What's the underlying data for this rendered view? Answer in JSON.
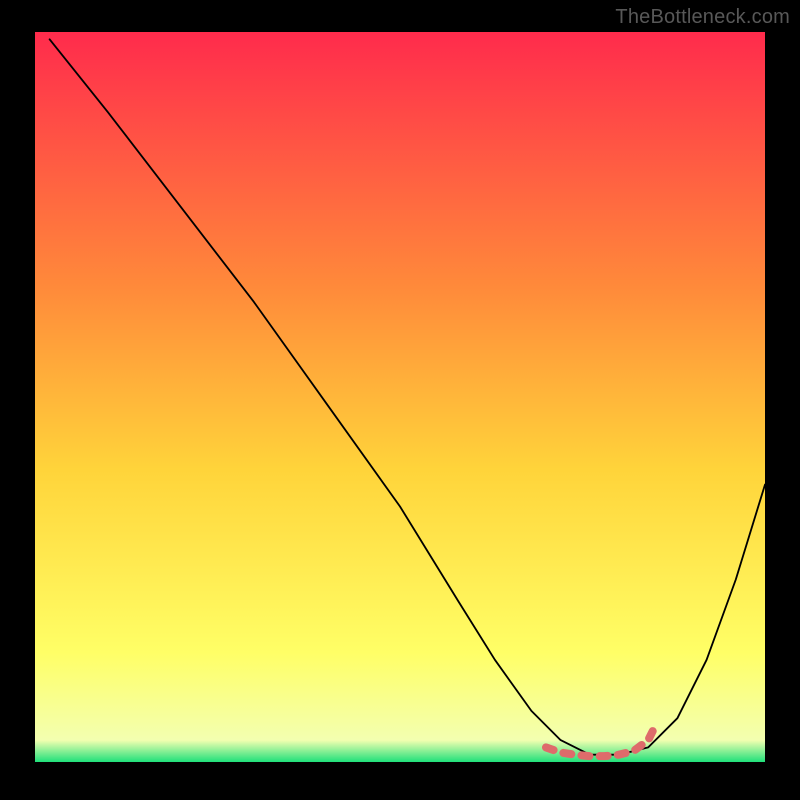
{
  "watermark": "TheBottleneck.com",
  "chart_data": {
    "type": "line",
    "title": "",
    "xlabel": "",
    "ylabel": "",
    "xlim": [
      0,
      100
    ],
    "ylim": [
      0,
      100
    ],
    "background_gradient": {
      "top": "#ff2b4c",
      "mid1": "#ff8a3a",
      "mid2": "#ffd43a",
      "mid3": "#ffff66",
      "bottom": "#1fe07a"
    },
    "series": [
      {
        "name": "bottleneck-curve",
        "color": "#000000",
        "x": [
          2,
          10,
          20,
          30,
          40,
          50,
          58,
          63,
          68,
          72,
          76,
          80,
          84,
          88,
          92,
          96,
          100
        ],
        "y": [
          99,
          89,
          76,
          63,
          49,
          35,
          22,
          14,
          7,
          3,
          1,
          1,
          2,
          6,
          14,
          25,
          38
        ]
      }
    ],
    "flat_bottom": {
      "x_start": 70,
      "x_end": 85,
      "y": 1
    },
    "markers": {
      "name": "optimal-zone",
      "color": "#de6b6b",
      "style": "dashed",
      "x": [
        70,
        72,
        74,
        76,
        78,
        80,
        82,
        84,
        85
      ],
      "y": [
        2,
        1.3,
        1,
        0.8,
        0.8,
        1,
        1.5,
        3,
        5
      ]
    }
  }
}
